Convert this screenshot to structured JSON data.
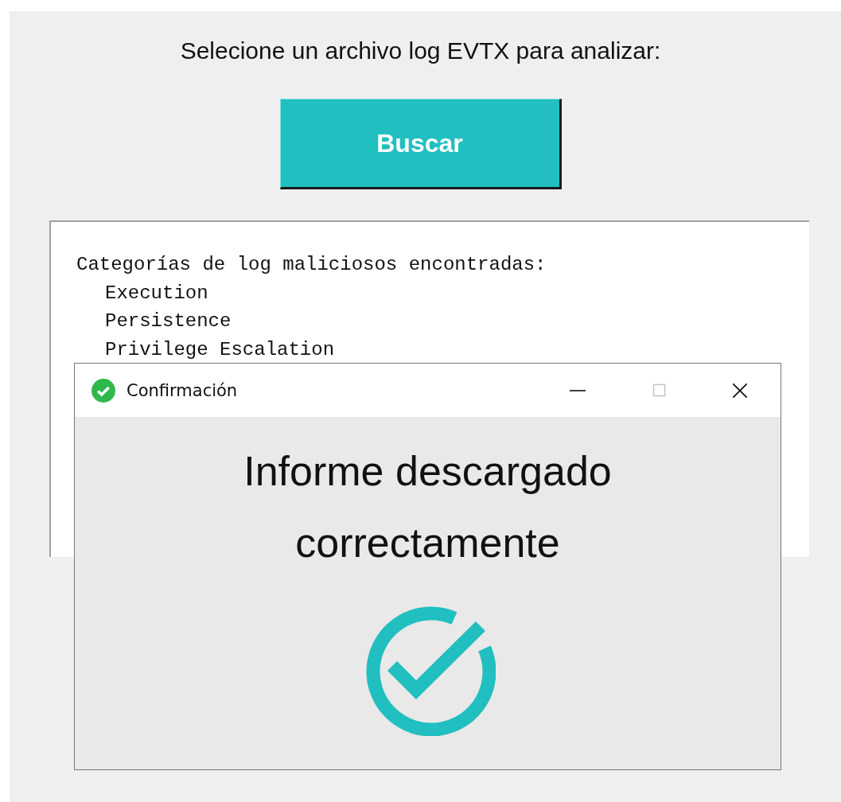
{
  "app": {
    "prompt": "Selecione un archivo log EVTX para analizar:",
    "button": "Buscar"
  },
  "output": {
    "heading": "Categorías de log maliciosos encontradas:",
    "categories": [
      "Execution",
      "Persistence",
      "Privilege Escalation"
    ]
  },
  "dialog": {
    "title": "Confirmación",
    "message": "Informe descargado correctamente",
    "controls": [
      {
        "kind": "minimize",
        "disabled": false
      },
      {
        "kind": "maximize",
        "disabled": true
      },
      {
        "kind": "close",
        "disabled": false
      }
    ]
  }
}
